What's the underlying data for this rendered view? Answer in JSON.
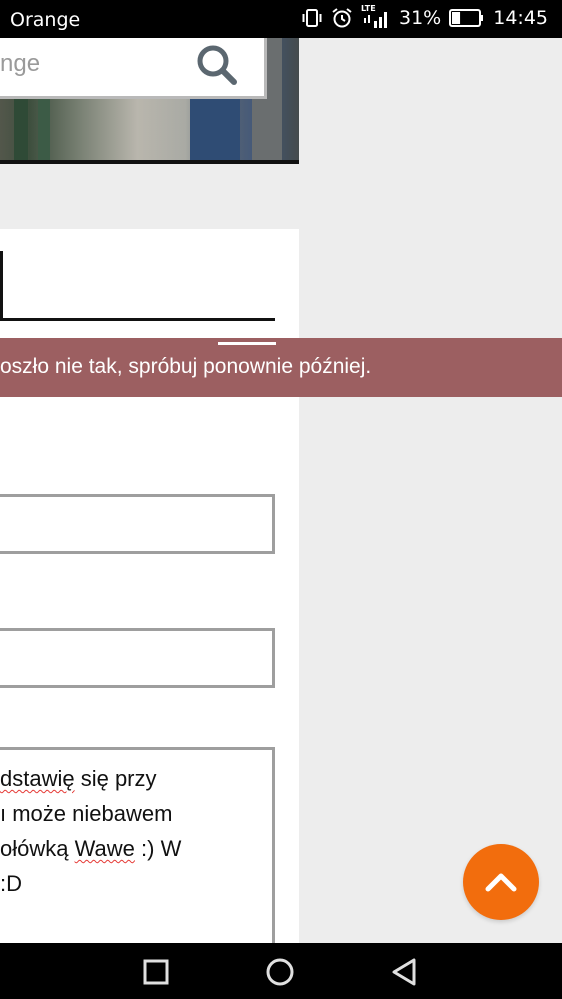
{
  "status_bar": {
    "carrier": "Orange",
    "network": "LTE",
    "battery_percent": "31%",
    "battery_level": 0.31,
    "time": "14:45"
  },
  "search": {
    "text": "nge"
  },
  "error": {
    "message": "oszło nie tak, spróbuj ponownie później."
  },
  "message": {
    "lines": [
      {
        "pre": "",
        "misspelled": "dstawię",
        "post": " się przy"
      },
      {
        "pre": "",
        "misspelled": "",
        "post": "ı może niebawem"
      },
      {
        "pre": "",
        "misspelled": "",
        "post": "ołówką ",
        "misspelled2": "Wawe",
        "post2": " :) W"
      },
      {
        "pre": "",
        "misspelled": "",
        "post": " :D"
      }
    ]
  },
  "colors": {
    "error_background": "#9c5f61",
    "fab_background": "#f26d0d",
    "spellcheck_underline": "#e53935"
  },
  "icons": {
    "search": "search-icon",
    "scroll_top": "chevron-up-icon",
    "nav_recent": "square-icon",
    "nav_home": "circle-icon",
    "nav_back": "triangle-back-icon"
  }
}
